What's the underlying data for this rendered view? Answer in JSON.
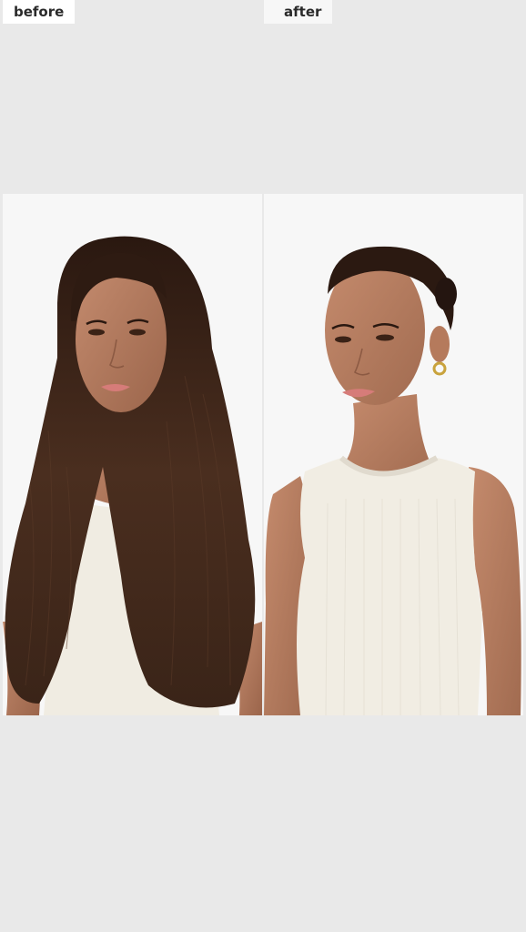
{
  "labels": {
    "before": "before",
    "after": "after"
  },
  "colors": {
    "page_background": "#e9e9e9",
    "panel_background": "#f7f7f7",
    "hair": "#3b2418",
    "skin": "#b98064",
    "top": "#f1ede3"
  }
}
